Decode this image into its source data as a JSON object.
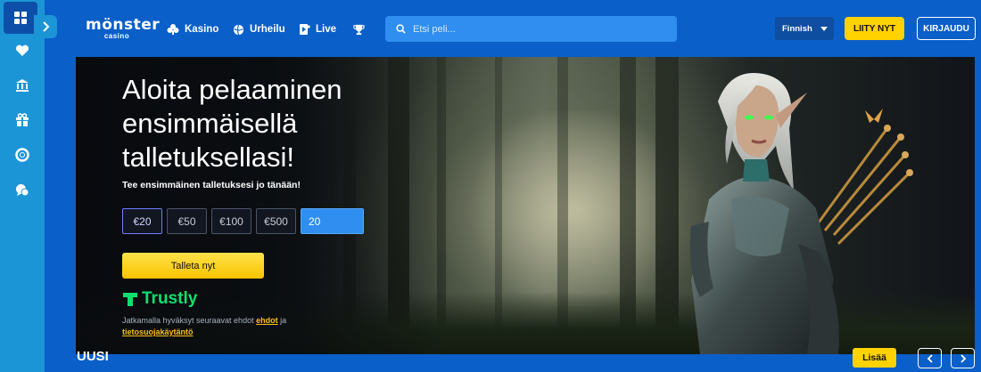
{
  "brand": {
    "logo_main": "mönster",
    "logo_sub": "casino"
  },
  "nav": {
    "items": [
      {
        "label": "Kasino",
        "icon": "club-icon"
      },
      {
        "label": "Urheilu",
        "icon": "ball-icon"
      },
      {
        "label": "Live",
        "icon": "live-icon"
      },
      {
        "label": "",
        "icon": "trophy-icon"
      }
    ]
  },
  "search": {
    "placeholder": "Etsi peli..."
  },
  "header": {
    "language": "Finnish",
    "join_label": "LIITY NYT",
    "login_label": "KIRJAUDU"
  },
  "sidebar": {
    "items": [
      {
        "icon": "dashboard-icon"
      },
      {
        "icon": "heart-icon"
      },
      {
        "icon": "casino-icon"
      },
      {
        "icon": "gift-icon"
      },
      {
        "icon": "lifebuoy-icon"
      },
      {
        "icon": "chat-icon"
      }
    ]
  },
  "hero": {
    "title": "Aloita pelaaminen ensimmäisellä talletuksellasi!",
    "subtitle": "Tee ensimmäinen talletuksesi jo tänään!",
    "amounts": [
      "€20",
      "€50",
      "€100",
      "€500"
    ],
    "selected_amount": "€20",
    "amount_value": "20",
    "deposit_label": "Talleta nyt",
    "payment_provider": "Trustly",
    "terms_prefix": "Jatkamalla hyväksyt seuraavat ehdot",
    "terms_link": "ehdot",
    "terms_and": "ja",
    "privacy_link": "tietosuojakäytäntö"
  },
  "section": {
    "title": "UUSI",
    "more_label": "Lisää"
  },
  "colors": {
    "page_bg": "#0a5fc9",
    "rail_bg": "#1c95d6",
    "accent_yellow": "#ffd200",
    "search_bg": "#2f8ef0",
    "trustly_green": "#0ee06e"
  }
}
